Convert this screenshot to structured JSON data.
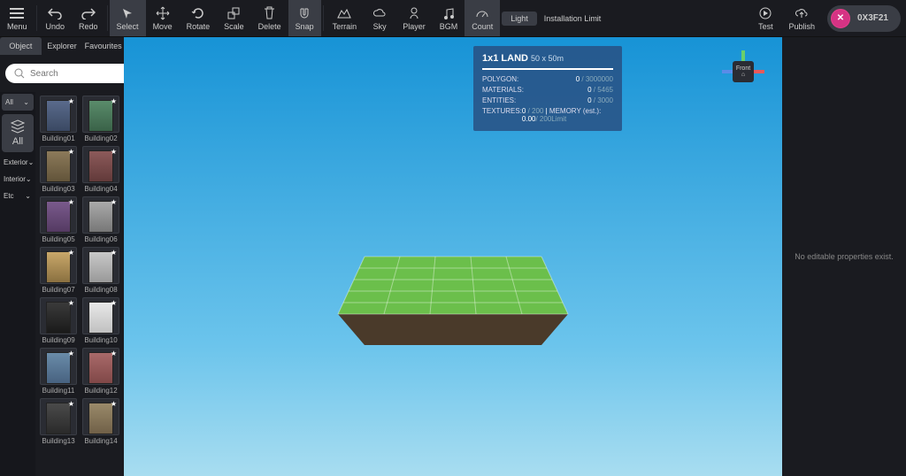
{
  "toolbar": {
    "menu": "Menu",
    "undo": "Undo",
    "redo": "Redo",
    "select": "Select",
    "move": "Move",
    "rotate": "Rotate",
    "scale": "Scale",
    "delete": "Delete",
    "snap": "Snap",
    "terrain": "Terrain",
    "sky": "Sky",
    "player": "Player",
    "bgm": "BGM",
    "count": "Count",
    "light_chip": "Light",
    "install_limit": "Installation Limit",
    "test": "Test",
    "publish": "Publish",
    "user": "0X3F21"
  },
  "left": {
    "tabs": {
      "object": "Object",
      "explorer": "Explorer",
      "favourites": "Favourites"
    },
    "search_placeholder": "Search",
    "categories": {
      "all_top": "All",
      "all": "All",
      "exterior": "Exterior",
      "interior": "Interior",
      "etc": "Etc"
    },
    "assets": [
      "Building01",
      "Building02",
      "Building03",
      "Building04",
      "Building05",
      "Building06",
      "Building07",
      "Building08",
      "Building09",
      "Building10",
      "Building11",
      "Building12",
      "Building13",
      "Building14"
    ]
  },
  "info": {
    "title": "1x1 LAND",
    "dim": "50 x 50m",
    "rows": {
      "polygon": {
        "label": "POLYGON:",
        "val": "0",
        "max": "/ 3000000"
      },
      "materials": {
        "label": "MATERIALS:",
        "val": "0",
        "max": "/ 5465"
      },
      "entities": {
        "label": "ENTITIES:",
        "val": "0",
        "max": "/ 3000"
      },
      "textures": {
        "label": "TEXTURES:",
        "val": "0",
        "max": "/ 200"
      },
      "memory": {
        "label": "MEMORY (est.):",
        "val": "0.00",
        "max": "/ 200Limit"
      }
    }
  },
  "gizmo": {
    "face": "Front"
  },
  "right": {
    "empty": "No editable properties exist."
  },
  "chart_data": {
    "type": "table",
    "name": "land-resource-budget",
    "rows": [
      {
        "metric": "POLYGON",
        "used": 0,
        "limit": 3000000
      },
      {
        "metric": "MATERIALS",
        "used": 0,
        "limit": 5465
      },
      {
        "metric": "ENTITIES",
        "used": 0,
        "limit": 3000
      },
      {
        "metric": "TEXTURES",
        "used": 0,
        "limit": 200
      },
      {
        "metric": "MEMORY_estimate",
        "used": 0.0,
        "limit": 200
      }
    ]
  }
}
